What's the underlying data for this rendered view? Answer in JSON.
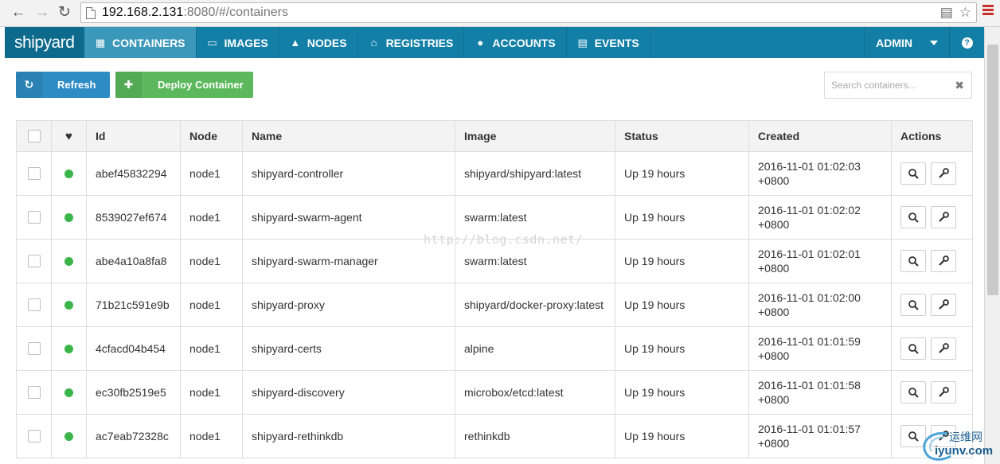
{
  "browser": {
    "url_host": "192.168.2.131",
    "url_path": ":8080/#/containers"
  },
  "brand": "shipyard",
  "nav": {
    "items": [
      {
        "label": "CONTAINERS",
        "icon": "th-list-icon",
        "active": true
      },
      {
        "label": "IMAGES",
        "icon": "hdd-icon",
        "active": false
      },
      {
        "label": "NODES",
        "icon": "sitemap-icon",
        "active": false
      },
      {
        "label": "REGISTRIES",
        "icon": "code-fork-icon",
        "active": false
      },
      {
        "label": "ACCOUNTS",
        "icon": "user-icon",
        "active": false
      },
      {
        "label": "EVENTS",
        "icon": "list-alt-icon",
        "active": false
      }
    ],
    "user": "ADMIN"
  },
  "toolbar": {
    "refresh_label": "Refresh",
    "deploy_label": "Deploy Container",
    "search_placeholder": "Search containers..."
  },
  "table": {
    "columns": [
      "",
      "",
      "Id",
      "Node",
      "Name",
      "Image",
      "Status",
      "Created",
      "Actions"
    ],
    "rows": [
      {
        "id": "abef45832294",
        "node": "node1",
        "name": "shipyard-controller",
        "image": "shipyard/shipyard:latest",
        "status": "Up 19 hours",
        "created_date": "2016-11-01 01:02:03",
        "created_tz": "+0800"
      },
      {
        "id": "8539027ef674",
        "node": "node1",
        "name": "shipyard-swarm-agent",
        "image": "swarm:latest",
        "status": "Up 19 hours",
        "created_date": "2016-11-01 01:02:02",
        "created_tz": "+0800"
      },
      {
        "id": "abe4a10a8fa8",
        "node": "node1",
        "name": "shipyard-swarm-manager",
        "image": "swarm:latest",
        "status": "Up 19 hours",
        "created_date": "2016-11-01 01:02:01",
        "created_tz": "+0800"
      },
      {
        "id": "71b21c591e9b",
        "node": "node1",
        "name": "shipyard-proxy",
        "image": "shipyard/docker-proxy:latest",
        "status": "Up 19 hours",
        "created_date": "2016-11-01 01:02:00",
        "created_tz": "+0800"
      },
      {
        "id": "4cfacd04b454",
        "node": "node1",
        "name": "shipyard-certs",
        "image": "alpine",
        "status": "Up 19 hours",
        "created_date": "2016-11-01 01:01:59",
        "created_tz": "+0800"
      },
      {
        "id": "ec30fb2519e5",
        "node": "node1",
        "name": "shipyard-discovery",
        "image": "microbox/etcd:latest",
        "status": "Up 19 hours",
        "created_date": "2016-11-01 01:01:58",
        "created_tz": "+0800"
      },
      {
        "id": "ac7eab72328c",
        "node": "node1",
        "name": "shipyard-rethinkdb",
        "image": "rethinkdb",
        "status": "Up 19 hours",
        "created_date": "2016-11-01 01:01:57",
        "created_tz": "+0800"
      }
    ]
  },
  "watermark": "http://blog.csdn.net/",
  "corner_logo": {
    "top": "运维网",
    "bottom": "iyunv.com"
  },
  "colors": {
    "nav_bg": "#137fa7",
    "nav_active": "#3b98bb",
    "refresh_btn": "#2e8cc4",
    "deploy_btn": "#5cb85c",
    "status_running": "#3bb54a"
  }
}
